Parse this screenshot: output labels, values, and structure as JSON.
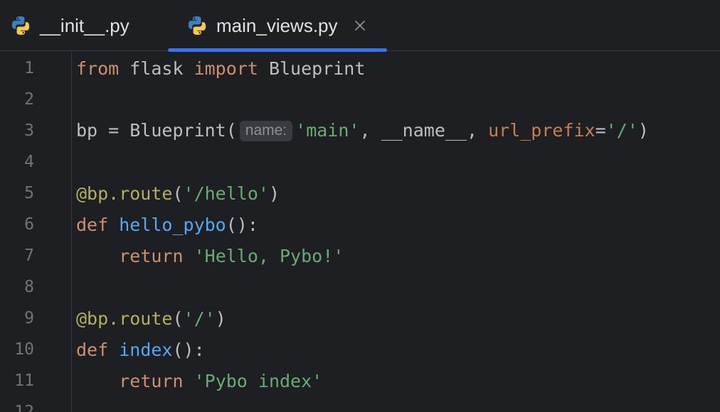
{
  "tabs": [
    {
      "label": "__init__.py",
      "icon": "python-file-icon",
      "active": false
    },
    {
      "label": "main_views.py",
      "icon": "python-file-icon",
      "active": true,
      "close_icon": "close-icon"
    }
  ],
  "colors": {
    "accent": "#3574f0",
    "keyword": "#cf8e6d",
    "string": "#6aab73",
    "decorator": "#b3ae60",
    "function": "#56a8f5",
    "parameter": "#c77d55",
    "text": "#bcbec4",
    "line_number": "#6f737a",
    "background": "#1e1f22"
  },
  "editor": {
    "line_numbers": [
      "1",
      "2",
      "3",
      "4",
      "5",
      "6",
      "7",
      "8",
      "9",
      "10",
      "11",
      "12"
    ],
    "lines": {
      "l1": {
        "kw1": "from",
        "t1": " flask ",
        "kw2": "import",
        "t2": " Blueprint"
      },
      "l3": {
        "t1": "bp = Blueprint(",
        "hint": "name:",
        "s1": "'main'",
        "t2": ", __name__, ",
        "p1": "url_prefix",
        "t3": "=",
        "s2": "'/'",
        "t4": ")"
      },
      "l5": {
        "d1": "@bp.route",
        "t1": "(",
        "s1": "'/hello'",
        "t2": ")"
      },
      "l6": {
        "kw1": "def",
        "t1": " ",
        "fn": "hello_pybo",
        "t2": "():"
      },
      "l7": {
        "indent": "    ",
        "kw1": "return",
        "t1": " ",
        "s1": "'Hello, Pybo!'"
      },
      "l9": {
        "d1": "@bp.route",
        "t1": "(",
        "s1": "'/'",
        "t2": ")"
      },
      "l10": {
        "kw1": "def",
        "t1": " ",
        "fn": "index",
        "t2": "():"
      },
      "l11": {
        "indent": "    ",
        "kw1": "return",
        "t1": " ",
        "s1": "'Pybo index'"
      }
    }
  }
}
